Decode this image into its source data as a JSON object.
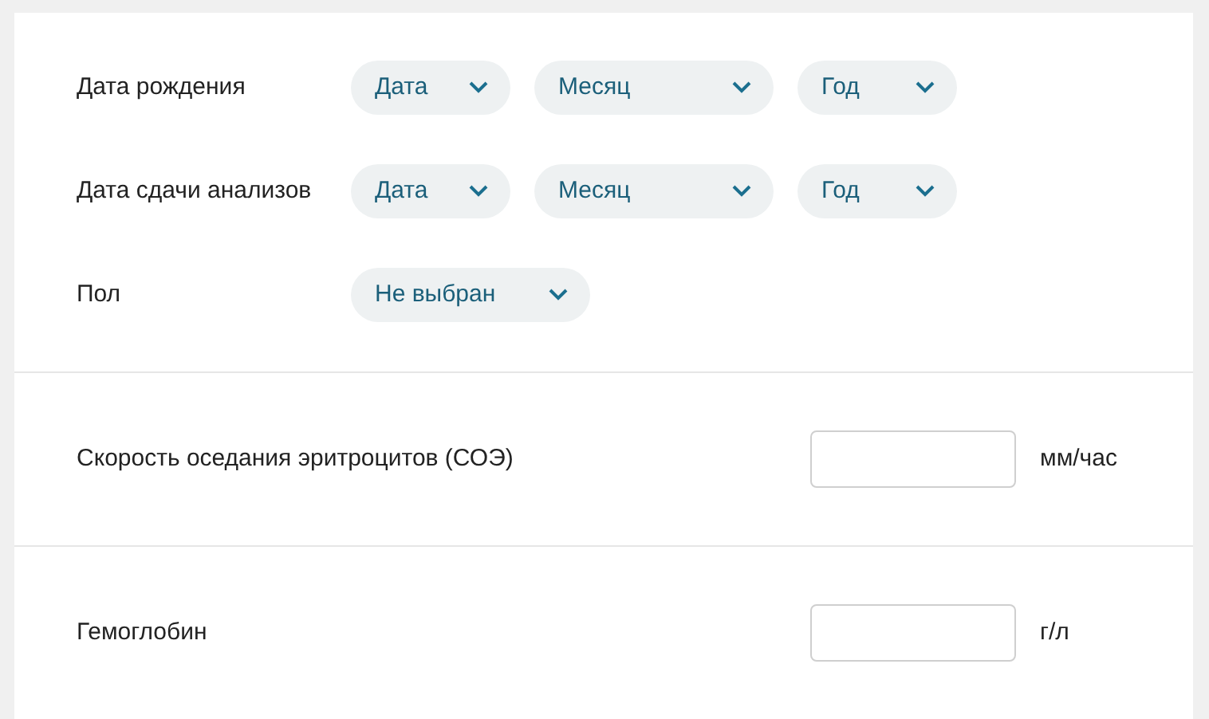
{
  "selects": [
    {
      "label": "Дата рождения",
      "dropdowns": [
        {
          "value": "Дата"
        },
        {
          "value": "Месяц"
        },
        {
          "value": "Год"
        }
      ]
    },
    {
      "label": "Дата сдачи анализов",
      "dropdowns": [
        {
          "value": "Дата"
        },
        {
          "value": "Месяц"
        },
        {
          "value": "Год"
        }
      ]
    },
    {
      "label": "Пол",
      "dropdowns": [
        {
          "value": "Не выбран"
        }
      ]
    }
  ],
  "measurements": [
    {
      "label": "Скорость оседания эритроцитов (СОЭ)",
      "unit": "мм/час"
    },
    {
      "label": "Гемоглобин",
      "unit": "г/л"
    }
  ]
}
